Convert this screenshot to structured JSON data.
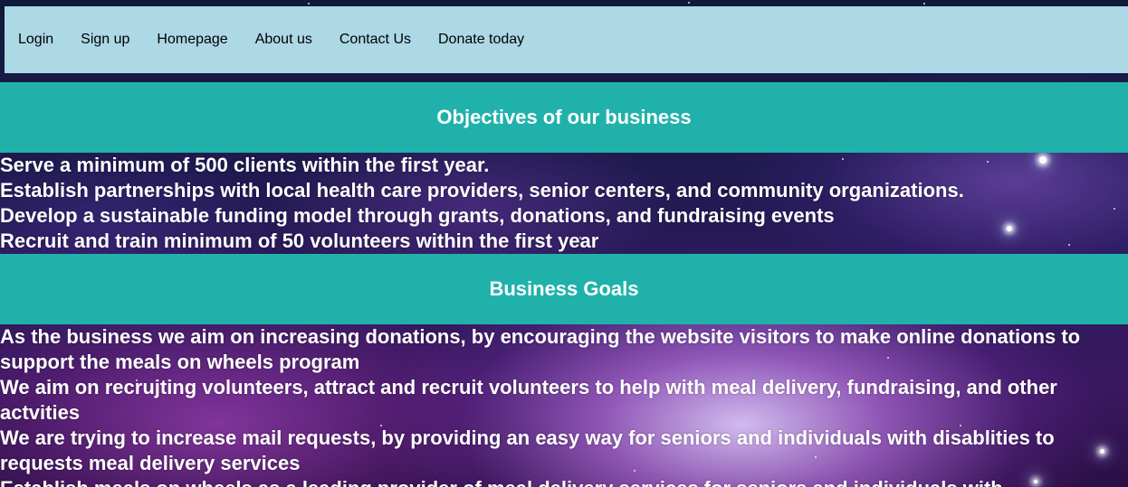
{
  "nav": {
    "items": [
      "Login",
      "Sign up",
      "Homepage",
      "About us",
      "Contact Us",
      "Donate today"
    ]
  },
  "objectives": {
    "heading": "Objectives of our business",
    "items": [
      "Serve a minimum of 500 clients within the first year.",
      "Establish partnerships with local health care providers, senior centers, and community organizations.",
      "Develop a sustainable funding model through grants, donations, and fundraising events",
      "Recruit and train minimum of 50 volunteers within the first year"
    ]
  },
  "goals": {
    "heading": "Business Goals",
    "items": [
      "As the business we aim on increasing donations, by encouraging the website visitors to make online donations to support the meals on wheels program",
      "We aim on recrujting volunteers, attract and recruit volunteers to help with meal delivery, fundraising, and other actvities",
      "We are trying to increase mail requests, by providing an easy way for seniors and individuals with disablities to requests meal delivery services",
      "Establish meals on wheels as a leading provider of meal delivery services for seniors and individuals with"
    ]
  },
  "colors": {
    "nav_bg": "#add8e6",
    "band_bg": "#20b2aa",
    "text_light": "#ffffff"
  }
}
